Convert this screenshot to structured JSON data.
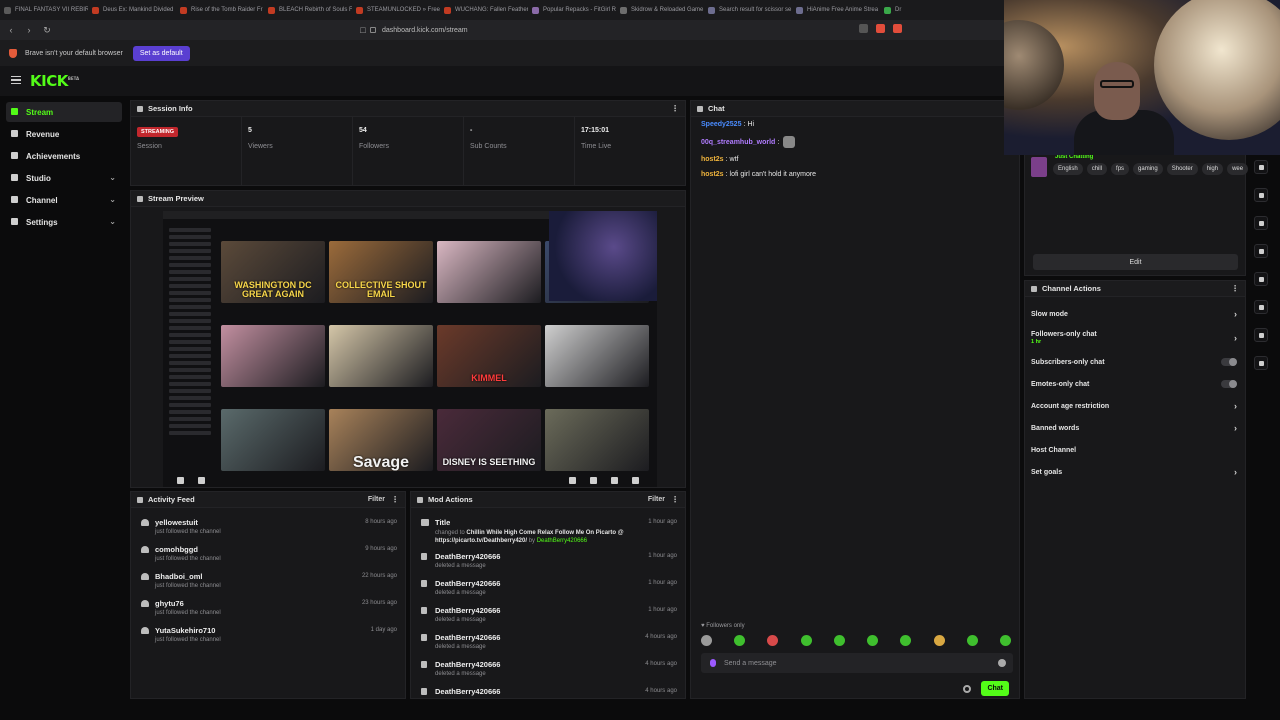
{
  "browser": {
    "tabs": [
      {
        "title": "FINAL FANTASY VII REBIRT",
        "color": "#5a5a5a"
      },
      {
        "title": "Deus Ex: Mankind Divided",
        "color": "#c23b22"
      },
      {
        "title": "Rise of the Tomb Raider Fr",
        "color": "#c23b22"
      },
      {
        "title": "BLEACH Rebirth of Souls Fr",
        "color": "#c23b22"
      },
      {
        "title": "STEAMUNLOCKED » Free S",
        "color": "#c23b22"
      },
      {
        "title": "WUCHANG: Fallen Feather",
        "color": "#c23b22"
      },
      {
        "title": "Popular Repacks - FitGirl R",
        "color": "#8a6aa8"
      },
      {
        "title": "Skidrow & Reloaded Game",
        "color": "#6d6d6d"
      },
      {
        "title": "Search result for scissor se",
        "color": "#6d6d8f"
      },
      {
        "title": "HiAnime Free Anime Strea",
        "color": "#6d6d8f"
      },
      {
        "title": "Dr",
        "color": "#3aa84a"
      }
    ],
    "url": "dashboard.kick.com/stream",
    "infobar_text": "Brave isn't your default browser",
    "set_default_label": "Set as default"
  },
  "app": {
    "logo": "KICK",
    "logo_badge": "BETA",
    "accent": "#53fc18"
  },
  "sidebar": {
    "items": [
      {
        "label": "Stream",
        "active": true,
        "has_chevron": false
      },
      {
        "label": "Revenue",
        "active": false,
        "has_chevron": false
      },
      {
        "label": "Achievements",
        "active": false,
        "has_chevron": false
      },
      {
        "label": "Studio",
        "active": false,
        "has_chevron": true
      },
      {
        "label": "Channel",
        "active": false,
        "has_chevron": true
      },
      {
        "label": "Settings",
        "active": false,
        "has_chevron": true
      }
    ]
  },
  "session": {
    "title": "Session Info",
    "status_badge": "STREAMING",
    "stats": [
      {
        "value": "",
        "label": "Session"
      },
      {
        "value": "5",
        "label": "Viewers"
      },
      {
        "value": "54",
        "label": "Followers"
      },
      {
        "value": "-",
        "label": "Sub Counts"
      },
      {
        "value": "17:15:01",
        "label": "Time Live"
      }
    ]
  },
  "preview": {
    "title": "Stream Preview",
    "thumbs": [
      {
        "text": "WASHINGTON DC GREAT AGAIN",
        "style": "",
        "bg": "#5b4a3a"
      },
      {
        "text": "COLLECTIVE SHOUT EMAIL",
        "style": "",
        "bg": "#9b6b3b"
      },
      {
        "text": "",
        "style": "",
        "bg": "#d9b7c2"
      },
      {
        "text": "",
        "style": "",
        "bg": "#3b4a6b"
      },
      {
        "text": "",
        "style": "",
        "bg": "#c28fa0"
      },
      {
        "text": "",
        "style": "",
        "bg": "#d4c6a8"
      },
      {
        "text": "KIMMEL",
        "style": "red",
        "bg": "#6b3a2a"
      },
      {
        "text": "",
        "style": "",
        "bg": "#cfcfcf"
      },
      {
        "text": "",
        "style": "",
        "bg": "#5a6a6b"
      },
      {
        "text": "Savage",
        "style": "white",
        "bg": "#a8825a"
      },
      {
        "text": "DISNEY IS SEETHING",
        "style": "white-small",
        "bg": "#4a2a3a"
      },
      {
        "text": "",
        "style": "",
        "bg": "#6b6b5a"
      }
    ]
  },
  "chat": {
    "title": "Chat",
    "messages": [
      {
        "user": "Speedy2525",
        "text": "Hi",
        "color": "#4a8cff",
        "emote": false
      },
      {
        "user": "00q_streamhub_world",
        "text": "",
        "color": "#b07cff",
        "emote": true
      },
      {
        "user": "host2s",
        "text": "wtf",
        "color": "#f0b43c",
        "emote": false
      },
      {
        "user": "host2s",
        "text": "lofi girl can't hold it anymore",
        "color": "#f0b43c",
        "emote": false
      }
    ],
    "followers_only": "Followers only",
    "input_placeholder": "Send a message",
    "send_label": "Chat"
  },
  "activity": {
    "title": "Activity Feed",
    "filter_label": "Filter",
    "items": [
      {
        "name": "yellowestuit",
        "sub": "just followed the channel",
        "time": "8 hours ago"
      },
      {
        "name": "comohbggd",
        "sub": "just followed the channel",
        "time": "9 hours ago"
      },
      {
        "name": "Bhadboi_oml",
        "sub": "just followed the channel",
        "time": "22 hours ago"
      },
      {
        "name": "ghytu76",
        "sub": "just followed the channel",
        "time": "23 hours ago"
      },
      {
        "name": "YutaSukehiro710",
        "sub": "just followed the channel",
        "time": "1 day ago"
      }
    ]
  },
  "mod": {
    "title": "Mod Actions",
    "filter_label": "Filter",
    "first": {
      "name": "Title",
      "prefix": "changed to",
      "value": "Chillin While High Come Relax Follow Me On Picarto @ https://picarto.tv/Deathberry420/",
      "by": "by",
      "user": "DeathBerry420666",
      "time": "1 hour ago"
    },
    "items": [
      {
        "name": "DeathBerry420666",
        "sub": "deleted a message",
        "time": "1 hour ago"
      },
      {
        "name": "DeathBerry420666",
        "sub": "deleted a message",
        "time": "1 hour ago"
      },
      {
        "name": "DeathBerry420666",
        "sub": "deleted a message",
        "time": "1 hour ago"
      },
      {
        "name": "DeathBerry420666",
        "sub": "deleted a message",
        "time": "4 hours ago"
      },
      {
        "name": "DeathBerry420666",
        "sub": "deleted a message",
        "time": "4 hours ago"
      },
      {
        "name": "DeathBerry420666",
        "sub": "",
        "time": "4 hours ago"
      }
    ]
  },
  "stream_info": {
    "category": "Just Chatting",
    "tags": [
      "English",
      "chill",
      "fps",
      "gaming",
      "Shooter",
      "high",
      "wee"
    ],
    "edit_label": "Edit"
  },
  "channel_actions": {
    "title": "Channel Actions",
    "items": [
      {
        "label": "Slow mode",
        "control": "arrow",
        "sub": ""
      },
      {
        "label": "Followers-only chat",
        "control": "arrow",
        "sub": "1 hr"
      },
      {
        "label": "Subscribers-only chat",
        "control": "toggle",
        "sub": ""
      },
      {
        "label": "Emotes-only chat",
        "control": "toggle",
        "sub": ""
      },
      {
        "label": "Account age restriction",
        "control": "arrow",
        "sub": ""
      },
      {
        "label": "Banned words",
        "control": "arrow",
        "sub": ""
      },
      {
        "label": "Host Channel",
        "control": "none",
        "sub": ""
      },
      {
        "label": "Set goals",
        "control": "arrow",
        "sub": ""
      }
    ]
  }
}
